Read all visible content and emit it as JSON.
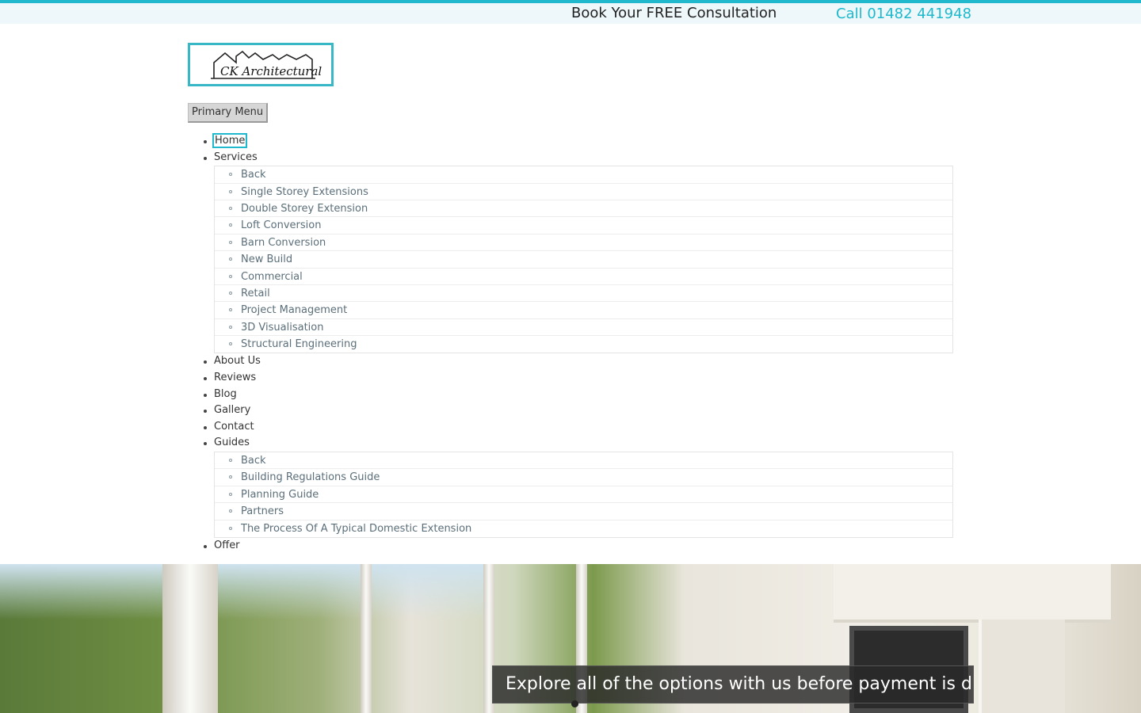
{
  "topbar": {
    "consultation_text": "Book Your FREE Consultation",
    "call_text": "Call 01482 441948",
    "accent_color": "#1fb8cc"
  },
  "logo": {
    "text": "CK Architectural"
  },
  "menu_toggle": {
    "label": "Primary Menu"
  },
  "nav": {
    "items": [
      {
        "label": "Home"
      },
      {
        "label": "Services"
      },
      {
        "label": "About Us"
      },
      {
        "label": "Reviews"
      },
      {
        "label": "Blog"
      },
      {
        "label": "Gallery"
      },
      {
        "label": "Contact"
      },
      {
        "label": "Guides"
      },
      {
        "label": "Offer"
      }
    ],
    "services_sub": [
      "Back",
      "Single Storey Extensions",
      "Double Storey Extension",
      "Loft Conversion",
      "Barn Conversion",
      "New Build",
      "Commercial",
      "Retail",
      "Project Management",
      "3D Visualisation",
      "Structural Engineering"
    ],
    "guides_sub": [
      "Back",
      "Building Regulations Guide",
      "Planning Guide",
      "Partners",
      "The Process Of A Typical Domestic Extension"
    ]
  },
  "hero": {
    "caption": "Explore all of the options with us before payment is due"
  }
}
